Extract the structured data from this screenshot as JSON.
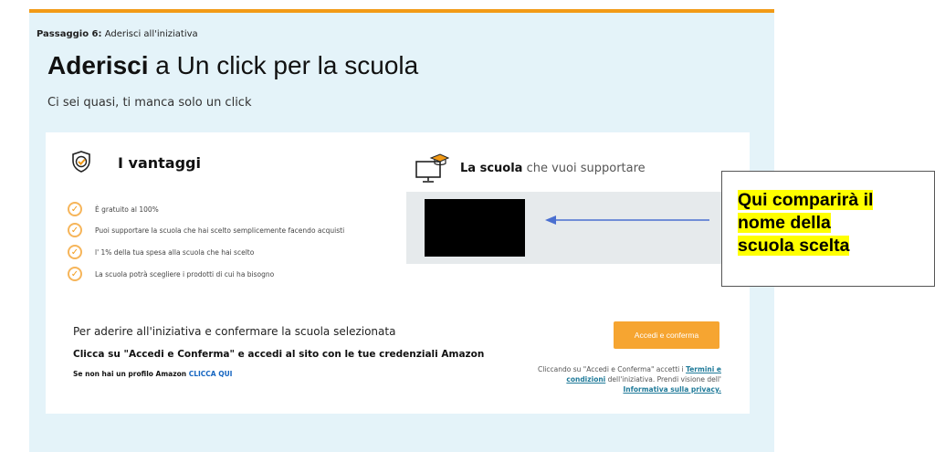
{
  "colors": {
    "accent_orange": "#f29a16",
    "panel_background": "#e4f3f9",
    "link_blue": "#1565c0",
    "callout_highlight": "#ffff00",
    "arrow_blue": "#4a6fd0"
  },
  "step": {
    "label": "Passaggio 6:",
    "text": "Aderisci all'iniziativa"
  },
  "title": {
    "bold": "Aderisci",
    "rest": "a Un click per la scuola"
  },
  "subtitle": "Ci sei quasi, ti manca solo un click",
  "vantaggi": {
    "icon": "shield-check-icon",
    "title": "I vantaggi",
    "items": [
      "È gratuito al 100%",
      "Puoi supportare la scuola che hai scelto semplicemente facendo acquisti",
      "l' 1% della tua spesa alla scuola che hai scelto",
      "La scuola potrà scegliere i prodotti di cui ha bisogno"
    ]
  },
  "school": {
    "icon": "monitor-graduation-cap-icon",
    "title_bold": "La scuola",
    "title_rest": "che vuoi supportare"
  },
  "join": {
    "text": "Per aderire all'iniziativa e confermare la scuola selezionata",
    "instruction": "Clicca su \"Accedi e Conferma\" e accedi al sito con le tue credenziali Amazon",
    "no_profile": "Se non hai un profilo Amazon",
    "no_profile_link": "CLICCA QUI"
  },
  "confirm_button": "Accedi e conferma",
  "terms": {
    "prefix": "Cliccando su \"Accedi e Conferma\" accetti i",
    "link1": "Termini e condizioni",
    "middle": "dell'iniziativa. Prendi visione dell'",
    "link2": "Informativa sulla privacy."
  },
  "callout": {
    "line1": "Qui comparirà il",
    "line2": "nome della",
    "line3": "scuola scelta"
  }
}
